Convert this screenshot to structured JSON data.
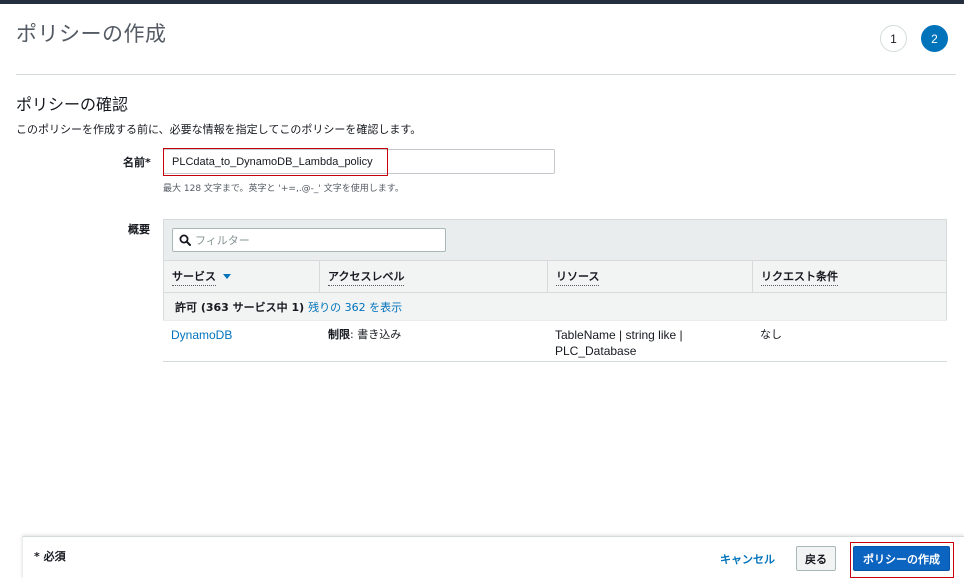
{
  "header": {
    "title": "ポリシーの作成",
    "steps": [
      "1",
      "2"
    ],
    "active_step": "2"
  },
  "review": {
    "title": "ポリシーの確認",
    "description": "このポリシーを作成する前に、必要な情報を指定してこのポリシーを確認します。",
    "name_label": "名前*",
    "name_value": "PLCdata_to_DynamoDB_Lambda_policy",
    "name_hint": "最大 128 文字まで。英字と '+=,.@-_' 文字を使用します。",
    "summary_label": "概要"
  },
  "summary": {
    "filter_placeholder": "フィルター",
    "columns": [
      "サービス",
      "アクセスレベル",
      "リソース",
      "リクエスト条件"
    ],
    "group": {
      "label": "許可 (363 サービス中 1)",
      "link": "残りの 362 を表示"
    },
    "rows": [
      {
        "service": "DynamoDB",
        "access_prefix": "制限",
        "access_value": ": 書き込み",
        "resource_line1": "TableName | string like |",
        "resource_line2": "PLC_Database",
        "condition": "なし"
      }
    ]
  },
  "footer": {
    "required": "* 必須",
    "cancel": "キャンセル",
    "back": "戻る",
    "create": "ポリシーの作成"
  },
  "colors": {
    "primary": "#0073bb",
    "highlight": "#c7000b",
    "topbar": "#232f3e"
  }
}
